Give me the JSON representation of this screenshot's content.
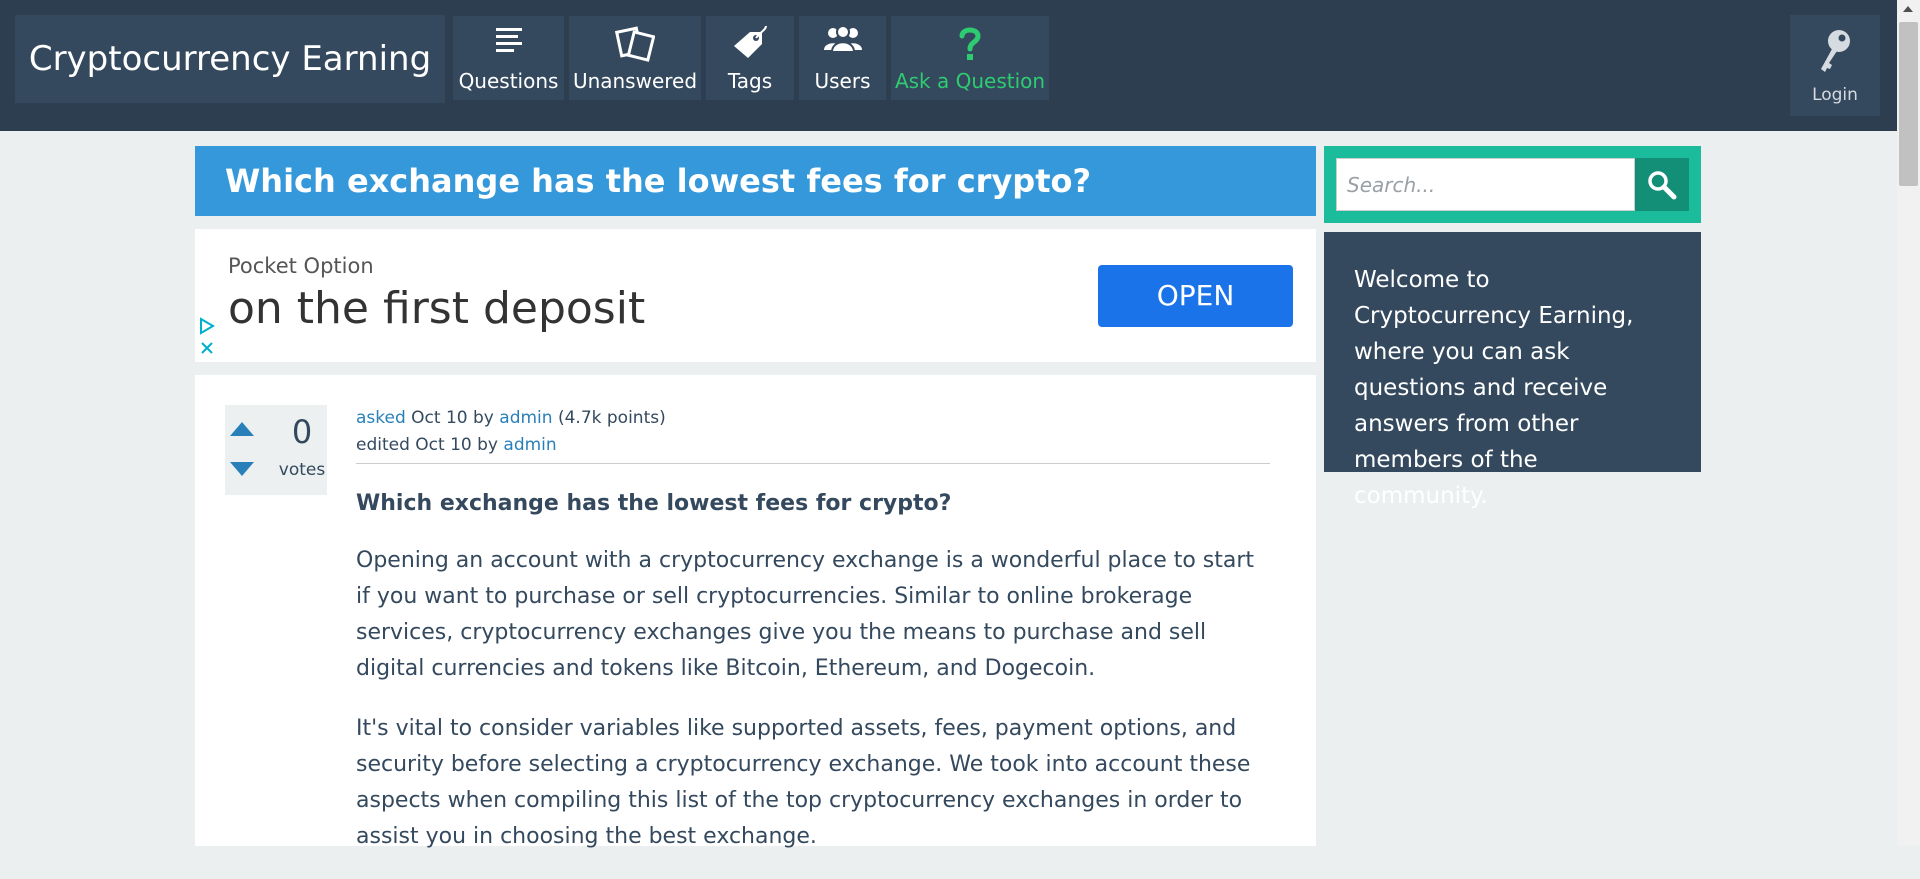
{
  "site": {
    "title": "Cryptocurrency Earning"
  },
  "nav": {
    "questions": "Questions",
    "unanswered": "Unanswered",
    "tags": "Tags",
    "users": "Users",
    "ask": "Ask a Question",
    "login": "Login"
  },
  "question": {
    "title": "Which exchange has the lowest fees for crypto?",
    "votes": "0",
    "votes_label": "votes",
    "meta": {
      "asked_link": "asked",
      "asked_date": "Oct 10",
      "by": "by",
      "asker": "admin",
      "points": "(4.7k points)",
      "edited": "edited",
      "edited_date": "Oct 10",
      "editor": "admin"
    },
    "body_heading": "Which exchange has the lowest fees for crypto?",
    "paragraphs": [
      "Opening an account with a cryptocurrency exchange is a wonderful place to start if you want to purchase or sell cryptocurrencies. Similar to online brokerage services, cryptocurrency exchanges give you the means to purchase and sell digital currencies and tokens like Bitcoin, Ethereum, and Dogecoin.",
      "It's vital to consider variables like supported assets, fees, payment options, and security before selecting a cryptocurrency exchange. We took into account these aspects when compiling this list of the top cryptocurrency exchanges in order to assist you in choosing the best exchange."
    ]
  },
  "ad": {
    "brand": "Pocket Option",
    "headline": "on the first deposit",
    "cta": "OPEN"
  },
  "search": {
    "placeholder": "Search..."
  },
  "sidebar": {
    "welcome": "Welcome to Cryptocurrency Earning, where you can ask questions and receive answers from other members of the community."
  },
  "colors": {
    "topbar": "#2c3e50",
    "nav_button": "#34495e",
    "title_bar": "#3498db",
    "search_bg": "#1abc9c",
    "ask_accent": "#2ecc71",
    "link": "#2980b9"
  },
  "icons": {
    "questions": "list-lines-icon",
    "unanswered": "cards-icon",
    "tags": "tag-icon",
    "users": "users-group-icon",
    "ask": "question-mark-icon",
    "login": "key-icon",
    "search": "magnifier-icon"
  }
}
